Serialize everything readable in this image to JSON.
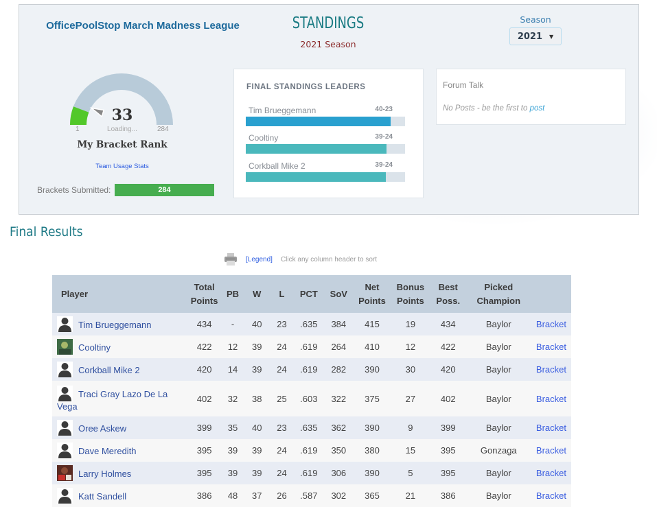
{
  "header": {
    "league_title": "OfficePoolStop March Madness League",
    "standings_title": "STANDINGS",
    "season_subtitle": "2021 Season",
    "season_label": "Season",
    "season_selected": "2021"
  },
  "rank": {
    "value": "33",
    "min_label": "1",
    "max_label": "284",
    "loading_text": "Loading...",
    "label": "My Bracket Rank",
    "gauge_fraction": 0.116,
    "usage_link": "Team Usage Stats",
    "submitted_label": "Brackets Submitted:",
    "submitted_value": "284",
    "colors": {
      "gauge_fill": "#52c82a",
      "gauge_track": "#b8cbd9",
      "submitted_bar": "#46ad4f"
    }
  },
  "leaders": {
    "title": "FINAL STANDINGS LEADERS",
    "items": [
      {
        "name": "Tim Brueggemann",
        "record": "40-23",
        "fraction": 0.91,
        "color": "#29a0cf"
      },
      {
        "name": "Cooltiny",
        "record": "39-24",
        "fraction": 0.885,
        "color": "#4ab8bc"
      },
      {
        "name": "Corkball Mike 2",
        "record": "39-24",
        "fraction": 0.88,
        "color": "#4ab8bc"
      }
    ]
  },
  "forum": {
    "title": "Forum Talk",
    "empty_text": "No Posts - be the first to ",
    "post_link": "post"
  },
  "results": {
    "title": "Final Results",
    "legend_link": "[Legend]",
    "sort_hint": "Click any column header to sort",
    "columns": [
      "Player",
      "Total Points",
      "PB",
      "W",
      "L",
      "PCT",
      "SoV",
      "Net Points",
      "Bonus Points",
      "Best Poss.",
      "Picked Champion",
      ""
    ],
    "rows": [
      {
        "player": "Tim Brueggemann",
        "avatar": "silhouette",
        "total": "434",
        "pb": "-",
        "w": "40",
        "l": "23",
        "pct": ".635",
        "sov": "384",
        "net": "415",
        "bonus": "19",
        "best": "434",
        "champion": "Baylor",
        "link": "Bracket"
      },
      {
        "player": "Cooltiny",
        "avatar": "photo-green",
        "total": "422",
        "pb": "12",
        "w": "39",
        "l": "24",
        "pct": ".619",
        "sov": "264",
        "net": "410",
        "bonus": "12",
        "best": "422",
        "champion": "Baylor",
        "link": "Bracket"
      },
      {
        "player": "Corkball Mike 2",
        "avatar": "silhouette",
        "total": "420",
        "pb": "14",
        "w": "39",
        "l": "24",
        "pct": ".619",
        "sov": "282",
        "net": "390",
        "bonus": "30",
        "best": "420",
        "champion": "Baylor",
        "link": "Bracket"
      },
      {
        "player": "Traci Gray Lazo De La Vega",
        "avatar": "silhouette",
        "total": "402",
        "pb": "32",
        "w": "38",
        "l": "25",
        "pct": ".603",
        "sov": "322",
        "net": "375",
        "bonus": "27",
        "best": "402",
        "champion": "Baylor",
        "link": "Bracket"
      },
      {
        "player": "Oree Askew",
        "avatar": "silhouette",
        "total": "399",
        "pb": "35",
        "w": "40",
        "l": "23",
        "pct": ".635",
        "sov": "362",
        "net": "390",
        "bonus": "9",
        "best": "399",
        "champion": "Baylor",
        "link": "Bracket"
      },
      {
        "player": "Dave Meredith",
        "avatar": "silhouette",
        "total": "395",
        "pb": "39",
        "w": "39",
        "l": "24",
        "pct": ".619",
        "sov": "350",
        "net": "380",
        "bonus": "15",
        "best": "395",
        "champion": "Gonzaga",
        "link": "Bracket"
      },
      {
        "player": "Larry Holmes",
        "avatar": "photo-red",
        "total": "395",
        "pb": "39",
        "w": "39",
        "l": "24",
        "pct": ".619",
        "sov": "306",
        "net": "390",
        "bonus": "5",
        "best": "395",
        "champion": "Baylor",
        "link": "Bracket"
      },
      {
        "player": "Katt Sandell",
        "avatar": "silhouette",
        "total": "386",
        "pb": "48",
        "w": "37",
        "l": "26",
        "pct": ".587",
        "sov": "302",
        "net": "365",
        "bonus": "21",
        "best": "386",
        "champion": "Baylor",
        "link": "Bracket"
      }
    ]
  }
}
